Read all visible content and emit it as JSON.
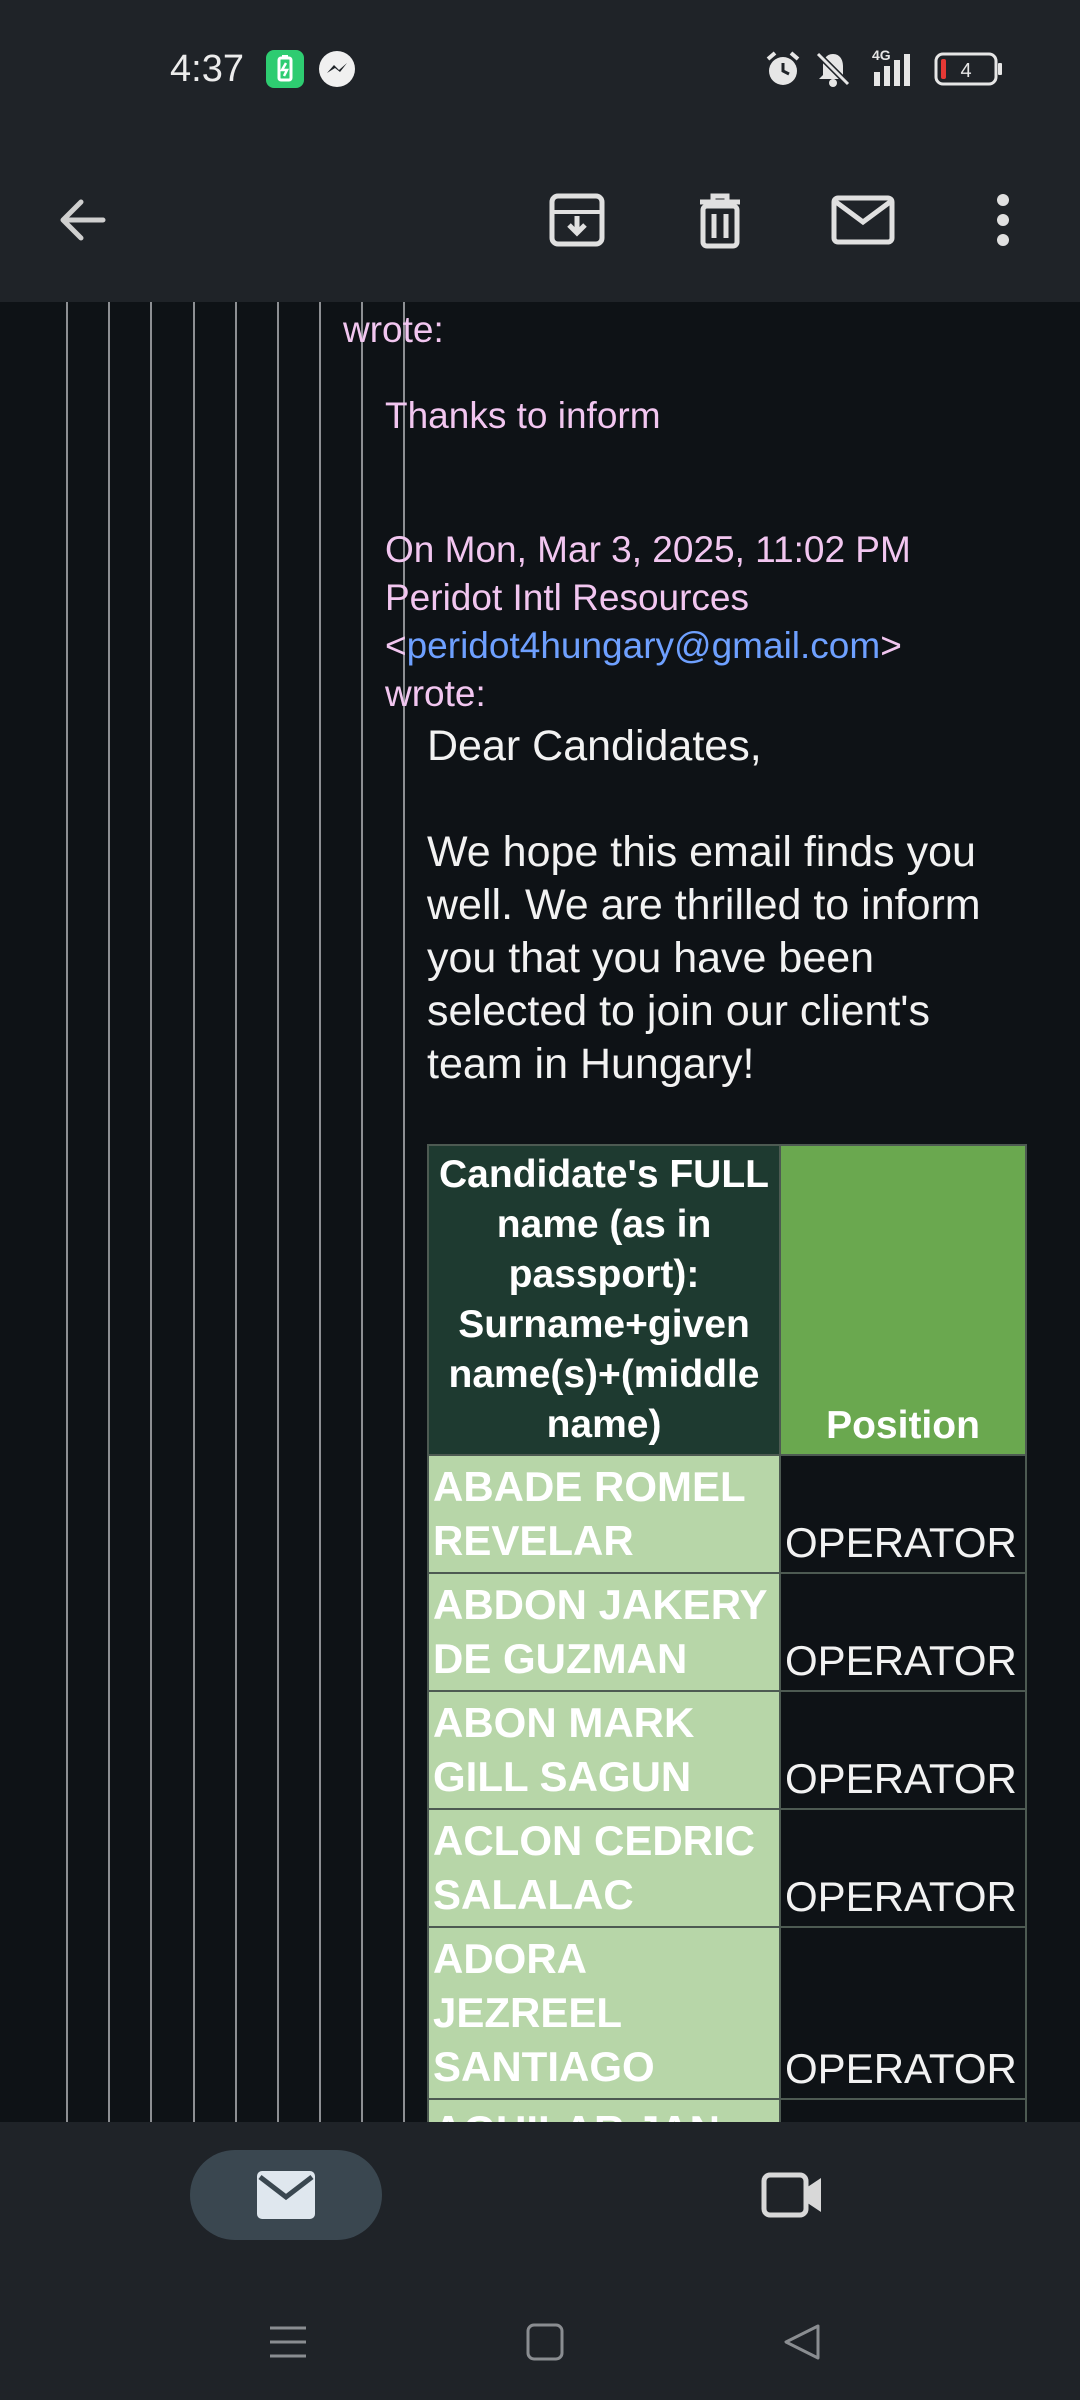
{
  "status_bar": {
    "time": "4:37",
    "network_label": "4G",
    "battery_level": "4",
    "icons": [
      "battery-saver-icon",
      "messenger-icon",
      "alarm-icon",
      "notifications-off-icon",
      "signal-icon",
      "battery-icon"
    ]
  },
  "app_bar": {
    "icons": [
      "back-arrow-icon",
      "archive-icon",
      "delete-icon",
      "mark-unread-icon",
      "more-vert-icon"
    ]
  },
  "email": {
    "prev_wrote": "wrote:",
    "reply_text": "Thanks to inform",
    "quote_header_line1": "On Mon, Mar 3, 2025, 11:02 PM",
    "quote_header_line2": "Peridot Intl Resources",
    "lt": "<",
    "sender_email": "peridot4hungary@gmail.com",
    "gt": ">",
    "wrote": "wrote:",
    "greeting": "Dear Candidates,",
    "body_lines": [
      "We hope this email finds you",
      "well. We are thrilled to inform",
      "you that you have been",
      "selected to join our client's",
      "team in Hungary!"
    ]
  },
  "table": {
    "header_name": "Candidate's FULL name (as in passport): Surname+given name(s)+(middle name)",
    "header_position": "Position",
    "rows": [
      {
        "name": "ABADE ROMEL REVELAR",
        "position": "OPERATOR"
      },
      {
        "name": "ABDON JAKERY DE GUZMAN",
        "position": "OPERATOR"
      },
      {
        "name": "ABON MARK GILL SAGUN",
        "position": "OPERATOR"
      },
      {
        "name": "ACLON CEDRIC SALALAC",
        "position": "OPERATOR"
      },
      {
        "name": "ADORA JEZREEL SANTIAGO",
        "position": "OPERATOR"
      },
      {
        "name": "AGUILAR JAN",
        "position": ""
      }
    ]
  },
  "bottom_nav": {
    "icons": [
      "mail-icon",
      "video-call-icon"
    ]
  },
  "system_nav": {
    "icons": [
      "recents-icon",
      "home-icon",
      "back-icon"
    ]
  },
  "colors": {
    "bar_bg": "#1f2328",
    "content_bg": "#0e1216",
    "quote_text": "#f2c6f0",
    "link": "#6ea0ff",
    "table_header_dark": "#1e3a30",
    "table_header_green": "#6aa84f",
    "table_name_cell": "#b7d6a8"
  }
}
